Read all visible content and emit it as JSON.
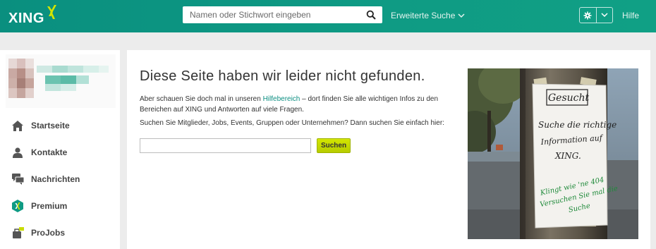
{
  "header": {
    "logo_text": "XING",
    "search_placeholder": "Namen oder Stichwort eingeben",
    "advanced_search": "Erweiterte Suche",
    "help": "Hilfe"
  },
  "sidebar": {
    "items": [
      {
        "label": "Startseite",
        "icon": "home-icon"
      },
      {
        "label": "Kontakte",
        "icon": "contacts-icon"
      },
      {
        "label": "Nachrichten",
        "icon": "messages-icon"
      },
      {
        "label": "Premium",
        "icon": "premium-icon"
      },
      {
        "label": "ProJobs",
        "icon": "projobs-icon"
      }
    ]
  },
  "main": {
    "title": "Diese Seite haben wir leider nicht gefunden.",
    "p1_before": "Aber schauen Sie doch mal in unseren ",
    "p1_link": "Hilfebereich",
    "p1_after": " – dort finden Sie alle wichtigen Infos zu den Bereichen auf XING und Antworten auf viele Fragen.",
    "p2": "Suchen Sie Mitglieder, Jobs, Events, Gruppen oder Unternehmen? Dann suchen Sie einfach hier:",
    "search_value": "",
    "search_button": "Suchen"
  },
  "photo": {
    "note_heading": "Gesucht",
    "note_black": [
      "Suche die richtige",
      "Information auf",
      "XING."
    ],
    "note_green": [
      "Klingt wie 'ne 404",
      "Versuchen Sie mal die",
      "Suche"
    ]
  },
  "colors": {
    "header_teal": "#0f9b84",
    "button_lime": "#c8dc00",
    "link_teal": "#0d8f82"
  }
}
